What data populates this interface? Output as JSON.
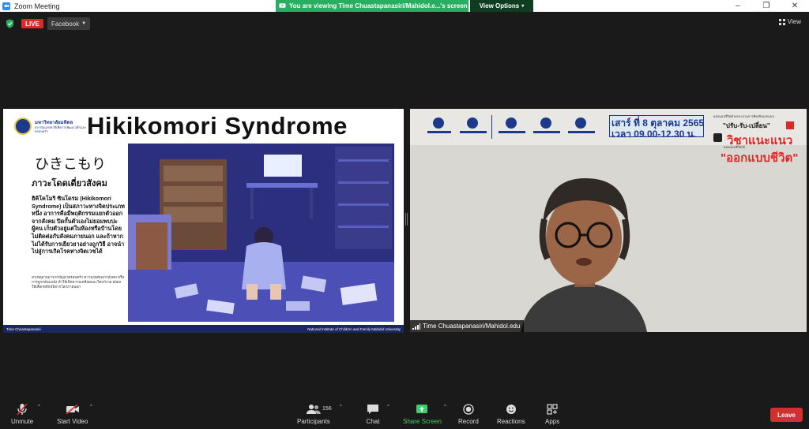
{
  "window": {
    "title": "Zoom Meeting",
    "minimize": "–",
    "maximize": "❐",
    "close": "✕"
  },
  "share_banner": {
    "text": "You are viewing Time Chuastapanasiri/Mahidol.e...'s screen",
    "view_options": "View Options",
    "color": "#27ae60"
  },
  "top_bar": {
    "live_label": "LIVE",
    "stream_target": "Facebook",
    "view_label": "View"
  },
  "slide": {
    "university_name": "มหาวิทยาลัยมหิดล",
    "university_sub": "สถาบันแห่งชาติเพื่อการพัฒนาเด็กและครอบครัว",
    "headline": "Hikikomori Syndrome",
    "japanese": "ひきこもり",
    "thai_title": "ภาวะโดดเดี่ยวสังคม",
    "body_bold": "ฮิคิโคโมริ ซินโดรม (Hikikomori Syndrome) เป็นสภาวะทางจิตประเภทหนึ่ง อาการคือมีพฤติกรรมแยกตัวออกจากสังคม ปิดกั้นตัวเองไม่ยอมพบปะผู้คน เก็บตัวอยู่แต่ในห้องหรือบ้านโดยไม่ติดต่อกับสังคมภายนอก และถ้าหากไม่ได้รับการเยียวยาอย่างถูกวิธี อาจนำไปสู่การเกิดโรคทางจิตเวชได้",
    "body_small": "สาเหตุอาจมาจากปัญหาครอบครัว ความกดดันจากสังคม หรือการถูกกลั่นแกล้ง ทำให้เกิดความเครียดและวิตกกังวล ส่งผลให้เลือกหลีกหนีจากโลกภายนอก",
    "footer_left": "Time Chuastapanasiri",
    "footer_right": "National Institute of Children and Family Mahidol University"
  },
  "video": {
    "date_line": "เสาร์ ที่ 8 ตุลาคม 2565",
    "time_line": "เวลา 09.00-12.30 น.",
    "small_top": "ออกแบบชีวิตด้วยกระบวนการคิดเชิงออกแบบ",
    "slogan": "\"ปรับ-รับ-เปลี่ยน\"",
    "subject": "วิชาแนะแนว",
    "small_sub": "ออกแบบชีวิตได้",
    "theme": "\"ออกแบบชีวิต\"",
    "participant_name": "Time Chuastapanasiri/Mahidol.edu"
  },
  "toolbar": {
    "unmute": "Unmute",
    "start_video": "Start Video",
    "participants": "Participants",
    "participant_count": "156",
    "chat": "Chat",
    "share_screen": "Share Screen",
    "record": "Record",
    "reactions": "Reactions",
    "apps": "Apps",
    "leave": "Leave"
  }
}
